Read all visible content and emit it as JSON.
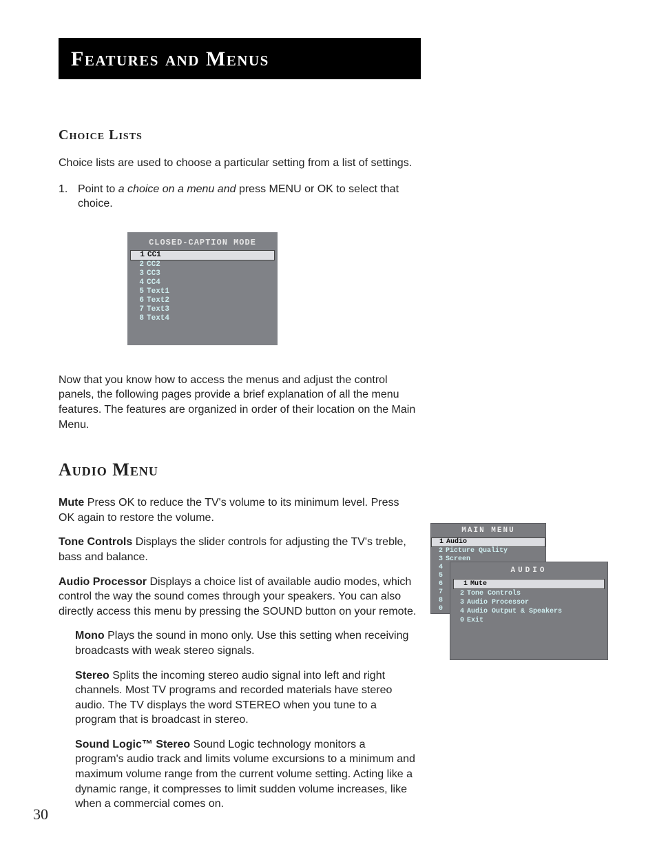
{
  "page_title": "Features and Menus",
  "page_number": "30",
  "choice_lists": {
    "heading": "Choice Lists",
    "intro": "Choice lists are used to choose a particular setting from a list of settings.",
    "step_number": "1.",
    "step_pre": "Point to ",
    "step_italic": "a choice on a menu and ",
    "step_post": "press MENU or OK to select that choice.",
    "outro": "Now that you know how to access the menus and adjust the control panels, the following pages provide a brief explanation of all the menu features. The features are organized in order of their location on the Main Menu."
  },
  "cc_panel": {
    "title": "CLOSED-CAPTION MODE",
    "items": [
      {
        "num": "1",
        "label": "CC1",
        "selected": true
      },
      {
        "num": "2",
        "label": "CC2",
        "selected": false
      },
      {
        "num": "3",
        "label": "CC3",
        "selected": false
      },
      {
        "num": "4",
        "label": "CC4",
        "selected": false
      },
      {
        "num": "5",
        "label": "Text1",
        "selected": false
      },
      {
        "num": "6",
        "label": "Text2",
        "selected": false
      },
      {
        "num": "7",
        "label": "Text3",
        "selected": false
      },
      {
        "num": "8",
        "label": "Text4",
        "selected": false
      }
    ]
  },
  "audio_menu": {
    "heading": "Audio Menu",
    "features": {
      "mute": {
        "label": "Mute",
        "desc": "  Press OK to reduce the TV's volume to its minimum level. Press OK again to restore the volume."
      },
      "tone": {
        "label": "Tone Controls",
        "desc": "   Displays the slider controls for adjusting the TV's treble, bass and balance."
      },
      "proc": {
        "label": "Audio Processor",
        "desc": "   Displays a choice list of available audio modes, which control the way the sound comes through your speakers. You can also directly access this menu by pressing the SOUND button on your remote."
      }
    },
    "submodes": {
      "mono": {
        "label": "Mono",
        "desc": "   Plays the sound in mono only. Use this setting when receiving broadcasts with weak stereo signals."
      },
      "stereo": {
        "label": "Stereo",
        "desc": "   Splits the incoming stereo audio signal into left and right channels. Most TV programs and recorded materials have stereo audio. The TV displays the word STEREO when you tune to a program that is broadcast in stereo."
      },
      "sls": {
        "label": "Sound Logic™ Stereo",
        "desc": "   Sound Logic technology monitors a program's audio track and limits volume excursions to a minimum and maximum volume range from the current volume setting. Acting like a dynamic range, it compresses to limit sudden volume increases, like when a commercial comes on."
      }
    }
  },
  "main_menu_panel": {
    "title": "MAIN MENU",
    "items": [
      {
        "num": "1",
        "label": "Audio",
        "selected": true,
        "num_only": false
      },
      {
        "num": "2",
        "label": "Picture Quality",
        "selected": false,
        "num_only": false
      },
      {
        "num": "3",
        "label": "Screen",
        "selected": false,
        "num_only": false
      },
      {
        "num": "4",
        "label": "",
        "selected": false,
        "num_only": true
      },
      {
        "num": "5",
        "label": "",
        "selected": false,
        "num_only": true
      },
      {
        "num": "6",
        "label": "",
        "selected": false,
        "num_only": true
      },
      {
        "num": "7",
        "label": "",
        "selected": false,
        "num_only": true
      },
      {
        "num": "8",
        "label": "",
        "selected": false,
        "num_only": true
      },
      {
        "num": "0",
        "label": "",
        "selected": false,
        "num_only": true
      }
    ]
  },
  "audio_panel": {
    "title": "AUDIO",
    "items": [
      {
        "num": "1",
        "label": "Mute",
        "selected": true
      },
      {
        "num": "2",
        "label": "Tone Controls",
        "selected": false
      },
      {
        "num": "3",
        "label": "Audio Processor",
        "selected": false
      },
      {
        "num": "4",
        "label": "Audio Output & Speakers",
        "selected": false
      },
      {
        "num": "0",
        "label": "Exit",
        "selected": false
      }
    ]
  }
}
